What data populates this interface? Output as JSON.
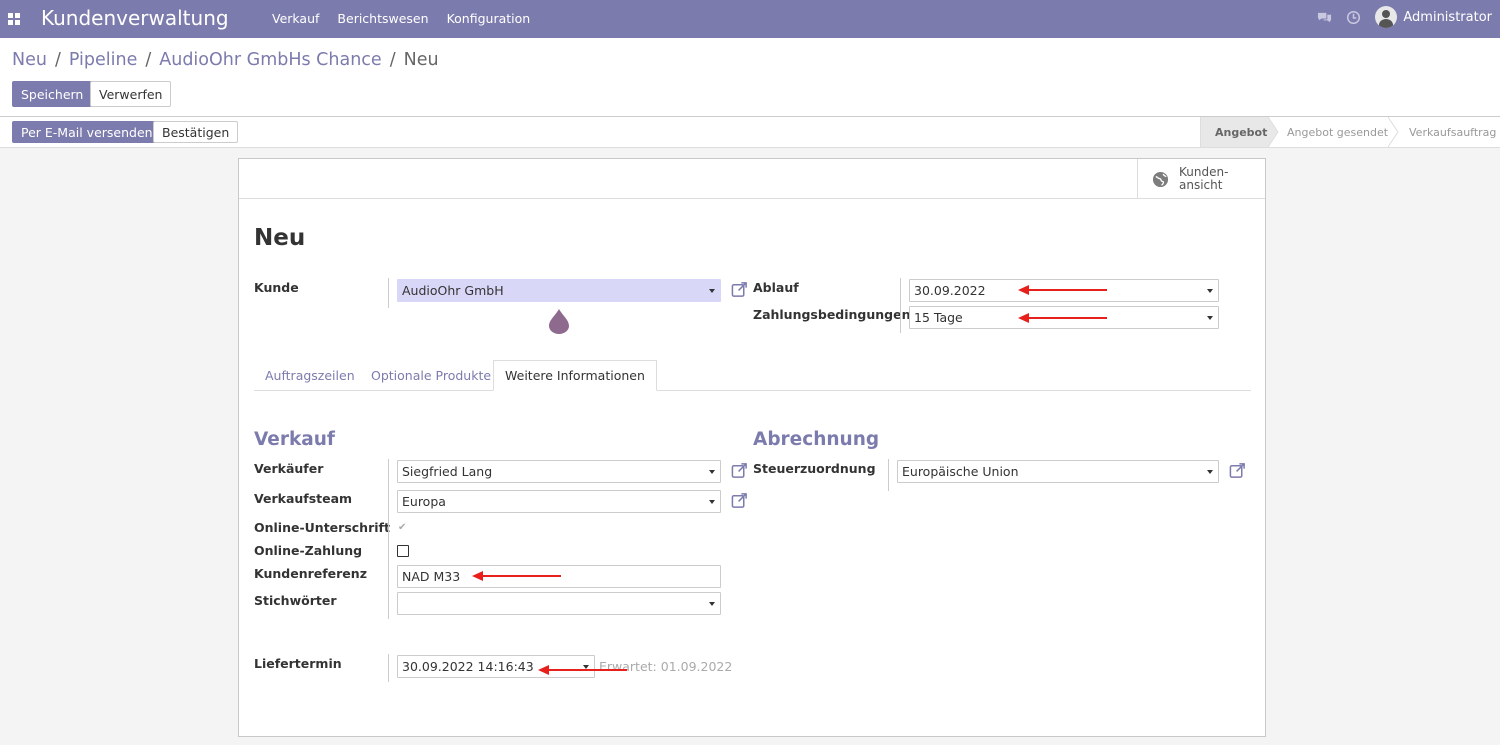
{
  "navbar": {
    "app_title": "Kundenverwaltung",
    "menu": [
      "Verkauf",
      "Berichtswesen",
      "Konfiguration"
    ],
    "user": "Administrator"
  },
  "breadcrumb": [
    "Neu",
    "Pipeline",
    "AudioOhr GmbHs Chance",
    "Neu"
  ],
  "actions": {
    "save": "Speichern",
    "discard": "Verwerfen"
  },
  "header_buttons": {
    "send_email": "Per E-Mail versenden",
    "confirm": "Bestätigen"
  },
  "statusbar": {
    "stages": [
      "Angebot",
      "Angebot gesendet",
      "Verkaufsauftrag"
    ],
    "current": "Angebot"
  },
  "smart_button": {
    "line1": "Kunden-",
    "line2": "ansicht",
    "icon": "globe-icon"
  },
  "form": {
    "title": "Neu",
    "customer_label": "Kunde",
    "customer_value": "AudioOhr GmbH",
    "expiration_label": "Ablauf",
    "expiration_value": "30.09.2022",
    "payment_terms_label": "Zahlungsbedingungen",
    "payment_terms_value": "15 Tage"
  },
  "tabs": [
    "Auftragszeilen",
    "Optionale Produkte",
    "Weitere Informationen"
  ],
  "active_tab": "Weitere Informationen",
  "sales": {
    "title": "Verkauf",
    "salesperson_label": "Verkäufer",
    "salesperson_value": "Siegfried Lang",
    "team_label": "Verkaufsteam",
    "team_value": "Europa",
    "online_signature_label": "Online-Unterschrift",
    "online_signature_checked": true,
    "online_payment_label": "Online-Zahlung",
    "online_payment_checked": false,
    "customer_ref_label": "Kundenreferenz",
    "customer_ref_value": "NAD M33",
    "tags_label": "Stichwörter",
    "tags_value": ""
  },
  "invoicing": {
    "title": "Abrechnung",
    "fiscal_position_label": "Steuerzuordnung",
    "fiscal_position_value": "Europäische Union"
  },
  "delivery": {
    "label": "Liefertermin",
    "value": "30.09.2022 14:16:43",
    "expected": "Erwartet: 01.09.2022"
  },
  "colors": {
    "brand": "#7c7bad",
    "annotation_arrow": "#e8201c",
    "highlight": "#d8d7f8"
  }
}
